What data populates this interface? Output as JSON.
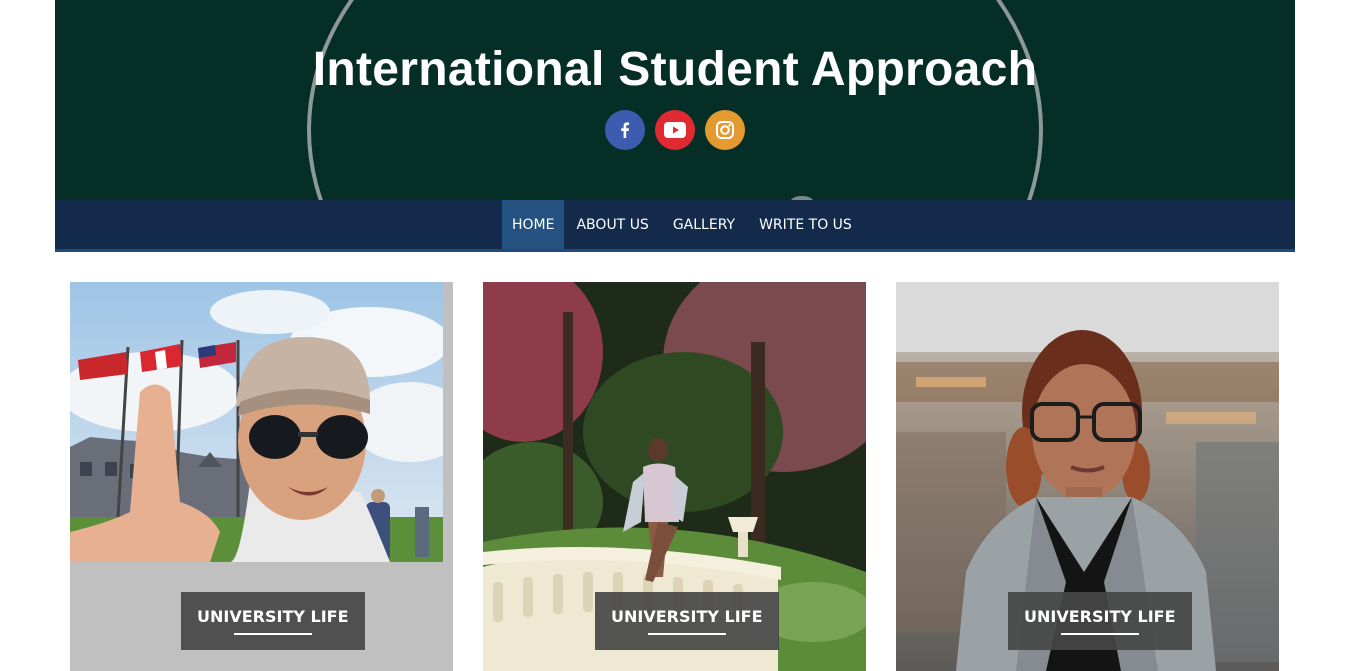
{
  "header": {
    "title": "International Student Approach",
    "socials": [
      {
        "name": "facebook",
        "icon": "facebook-icon",
        "color": "#3b5998"
      },
      {
        "name": "youtube",
        "icon": "youtube-icon",
        "color": "#e02a20"
      },
      {
        "name": "instagram",
        "icon": "instagram-icon",
        "color": "#e2992f"
      }
    ]
  },
  "nav": {
    "items": [
      {
        "label": "HOME",
        "active": true
      },
      {
        "label": "ABOUT US",
        "active": false
      },
      {
        "label": "GALLERY",
        "active": false
      },
      {
        "label": "WRITE TO US",
        "active": false
      }
    ]
  },
  "cards": [
    {
      "label": "UNIVERSITY LIFE"
    },
    {
      "label": "UNIVERSITY LIFE"
    },
    {
      "label": "UNIVERSITY LIFE"
    }
  ],
  "colors": {
    "header_bg": "#052e26",
    "nav_bg": "#132a4a",
    "nav_active": "#24517f"
  }
}
